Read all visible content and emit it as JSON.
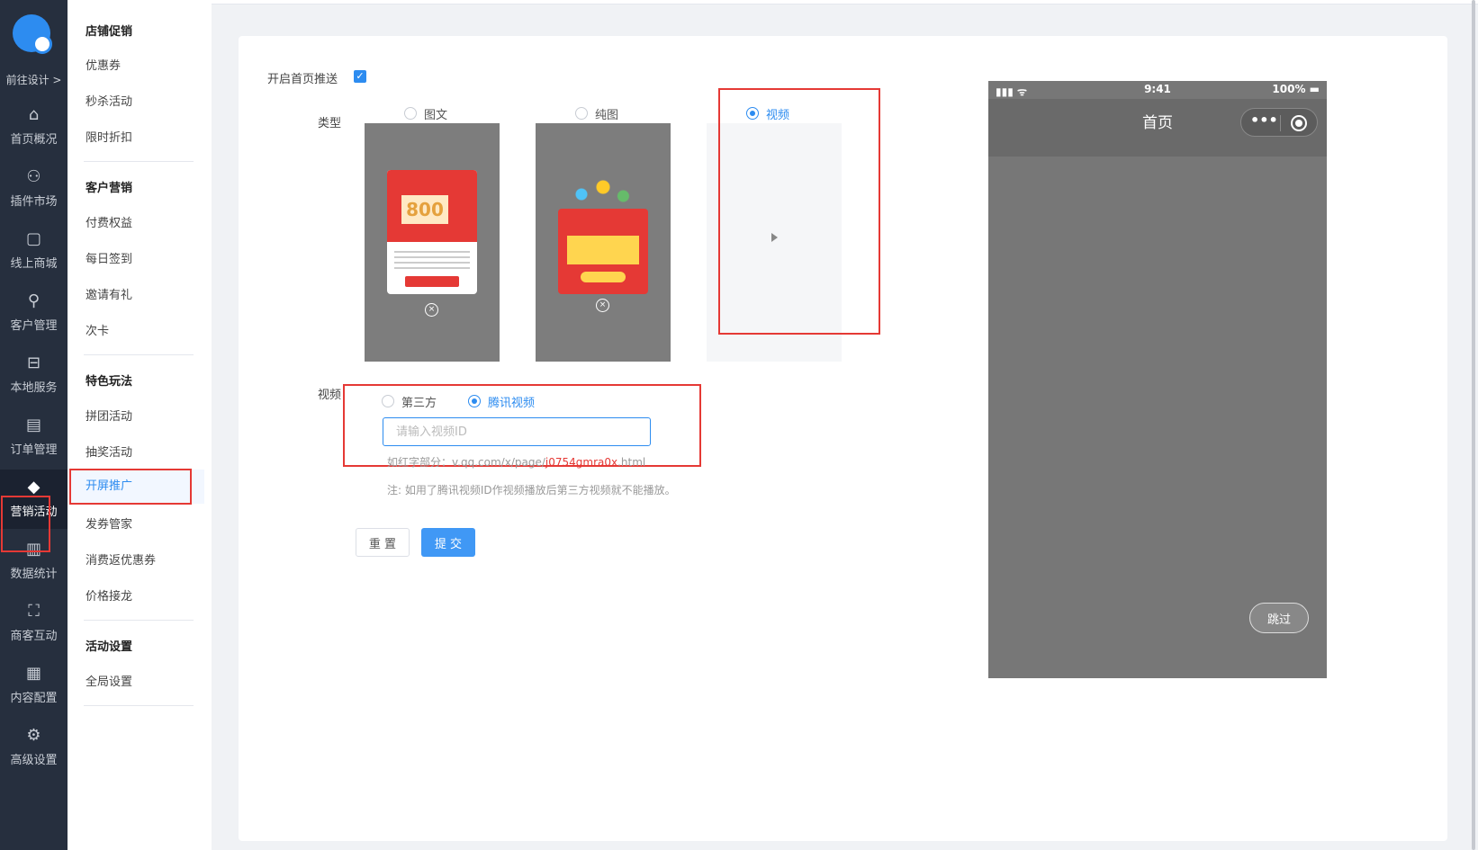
{
  "nav": {
    "design_link": "前往设计 >",
    "items": [
      {
        "label": "首页概况",
        "icon": "home-icon"
      },
      {
        "label": "插件市场",
        "icon": "grid-icon"
      },
      {
        "label": "线上商城",
        "icon": "bag-icon"
      },
      {
        "label": "客户管理",
        "icon": "user-icon"
      },
      {
        "label": "本地服务",
        "icon": "store-icon"
      },
      {
        "label": "订单管理",
        "icon": "clipboard-icon"
      },
      {
        "label": "营销活动",
        "icon": "diamond-icon"
      },
      {
        "label": "数据统计",
        "icon": "chart-icon"
      },
      {
        "label": "商客互动",
        "icon": "scan-icon"
      },
      {
        "label": "内容配置",
        "icon": "document-icon"
      },
      {
        "label": "高级设置",
        "icon": "gear-icon"
      }
    ],
    "active_index": 6
  },
  "submenu": {
    "groups": [
      {
        "title": "店铺促销",
        "items": [
          "优惠券",
          "秒杀活动",
          "限时折扣"
        ]
      },
      {
        "title": "客户营销",
        "items": [
          "付费权益",
          "每日签到",
          "邀请有礼",
          "次卡"
        ]
      },
      {
        "title": "特色玩法",
        "items": [
          "拼团活动",
          "抽奖活动",
          "开屏推广",
          "发券管家",
          "消费返优惠券",
          "价格接龙"
        ]
      },
      {
        "title": "活动设置",
        "items": [
          "全局设置"
        ]
      }
    ],
    "active_item": "开屏推广"
  },
  "form": {
    "enable_label": "开启首页推送",
    "enable_checked": true,
    "type_label": "类型",
    "type_options": [
      "图文",
      "纯图",
      "视频"
    ],
    "type_selected": "视频",
    "preview1": {
      "amount": "800"
    },
    "video_label": "视频",
    "video_source_options": [
      "第三方",
      "腾讯视频"
    ],
    "video_source_selected": "腾讯视频",
    "video_id_placeholder": "请输入视频ID",
    "hint_prefix": "如红字部分：",
    "hint_url_plain": "v.qq.com/x/page/",
    "hint_url_red": "j0754gmra0x",
    "hint_url_suffix": ".html",
    "note": "注: 如用了腾讯视频ID作视频播放后第三方视频就不能播放。",
    "reset_label": "重 置",
    "submit_label": "提 交"
  },
  "phone": {
    "signal": "▮▮▮ ᯤ",
    "time": "9:41",
    "battery": "100% ▬",
    "title": "首页",
    "capsule_dots": "•••",
    "skip_label": "跳过"
  },
  "colors": {
    "nav_bg": "#262f3e",
    "accent": "#2d8cf0",
    "highlight_box": "#e53935",
    "submit": "#4098f5"
  }
}
